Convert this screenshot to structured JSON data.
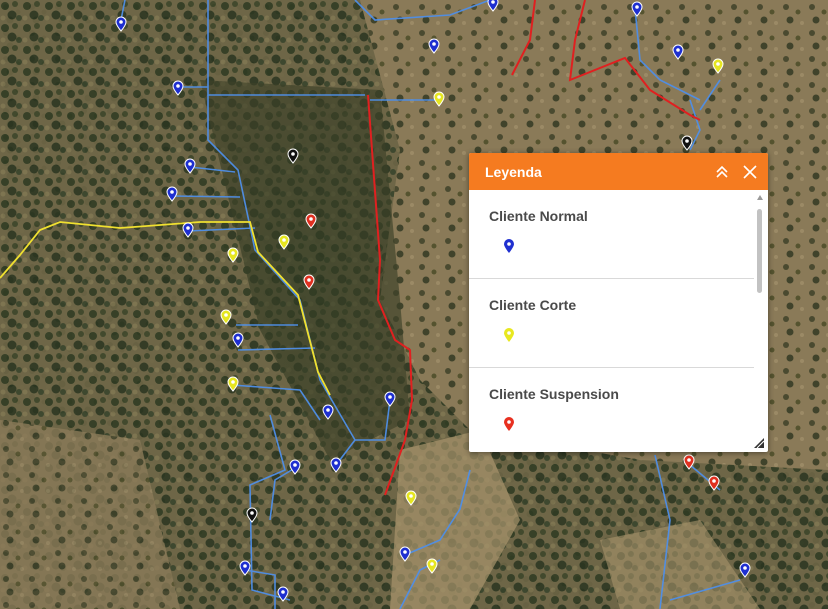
{
  "legend": {
    "title": "Leyenda",
    "items": [
      {
        "label": "Cliente Normal",
        "color": "#2030d0"
      },
      {
        "label": "Cliente Corte",
        "color": "#e8e820"
      },
      {
        "label": "Cliente Suspension",
        "color": "#e83020"
      }
    ]
  },
  "map": {
    "line_colors": {
      "service": "#4f8fe8",
      "main": "#4080e0",
      "boundary": "#e02020",
      "route": "#f0e030"
    },
    "marker_colors": {
      "normal": "#1e2fd0",
      "corte": "#e6e620",
      "suspension": "#e03020",
      "other": "#111111"
    }
  }
}
